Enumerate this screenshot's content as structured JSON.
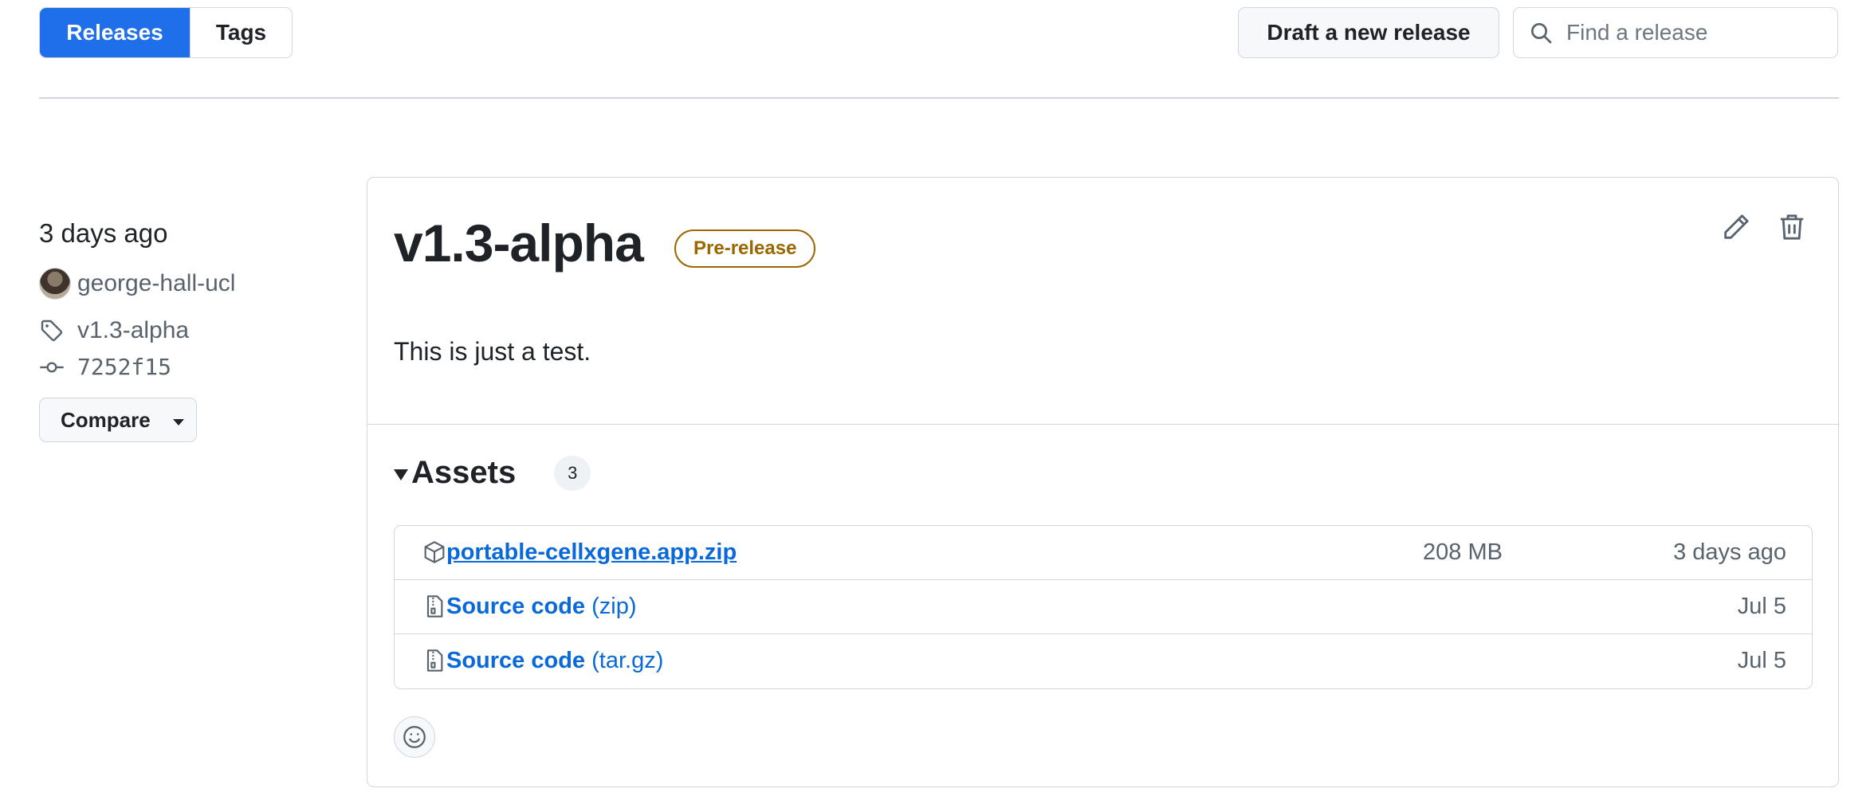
{
  "toolbar": {
    "tab_releases": "Releases",
    "tab_tags": "Tags",
    "draft_button": "Draft a new release",
    "search_placeholder": "Find a release"
  },
  "sidebar": {
    "date": "3 days ago",
    "author": "george-hall-ucl",
    "tag": "v1.3-alpha",
    "commit": "7252f15",
    "compare_button": "Compare"
  },
  "release": {
    "title": "v1.3-alpha",
    "badge": "Pre-release",
    "body": "This is just a test.",
    "assets_title": "Assets",
    "assets_count": "3",
    "assets": [
      {
        "name": "portable-cellxgene.app.zip",
        "suffix": "",
        "size": "208 MB",
        "date": "3 days ago",
        "icon": "package-icon"
      },
      {
        "name": "Source code",
        "suffix": "(zip)",
        "size": "",
        "date": "Jul 5",
        "icon": "file-zip-icon"
      },
      {
        "name": "Source code",
        "suffix": "(tar.gz)",
        "size": "",
        "date": "Jul 5",
        "icon": "file-zip-icon"
      }
    ]
  },
  "colors": {
    "accent": "#1f6feb",
    "link": "#0969da",
    "prerelease": "#9a6700",
    "border": "#d0d7de",
    "muted": "#59636e"
  }
}
